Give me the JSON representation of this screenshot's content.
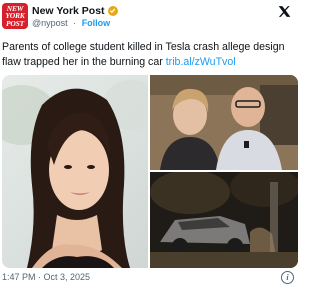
{
  "account": {
    "display_name": "New York Post",
    "handle": "@nypost",
    "separator": "·",
    "follow_label": "Follow",
    "avatar_text": [
      "NEW",
      "YORK",
      "POST"
    ],
    "verified_color": "#e8a915",
    "brand_color": "#d4212b"
  },
  "tweet": {
    "text": "Parents of college student killed in Tesla crash allege design flaw trapped her in the burning car",
    "link": "trib.al/zWuTvol",
    "link_color": "#1d9bf0"
  },
  "media": {
    "images": [
      "portrait-photo",
      "parents-interview-photo",
      "crash-scene-photo"
    ]
  },
  "footer": {
    "timestamp": "1:47 PM · Oct 3, 2025"
  },
  "icons": {
    "platform": "x-logo-icon",
    "verified": "verified-badge-icon",
    "info": "info-icon"
  }
}
